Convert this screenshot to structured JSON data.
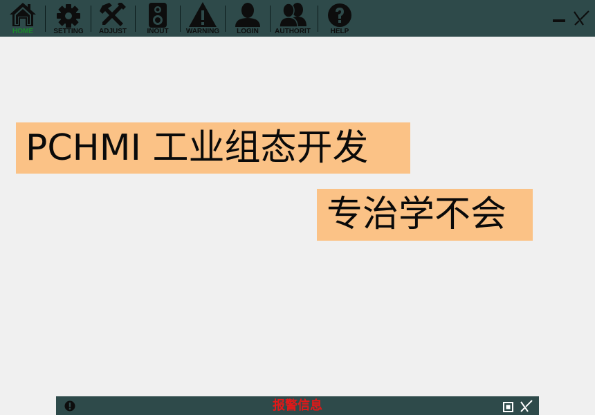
{
  "nav": {
    "items": [
      {
        "label": "HOME",
        "icon": "home-icon",
        "active": true
      },
      {
        "label": "SETTING",
        "icon": "gear-icon"
      },
      {
        "label": "ADJUST",
        "icon": "tools-icon"
      },
      {
        "label": "INOUT",
        "icon": "speaker-icon"
      },
      {
        "label": "WARNING",
        "icon": "warning-icon"
      },
      {
        "label": "LOGIN",
        "icon": "user-icon"
      },
      {
        "label": "AUTHORIT",
        "icon": "users-icon"
      },
      {
        "label": "HELP",
        "icon": "help-icon"
      }
    ]
  },
  "window": {
    "minimize_icon": "minimize-icon",
    "close_icon": "close-icon"
  },
  "main": {
    "banner_title": "PCHMI 工业组态开发",
    "banner_subtitle": "专治学不会"
  },
  "alarm": {
    "title": "报警信息",
    "info_icon": "alert-icon",
    "restore_icon": "restore-icon",
    "close_icon": "close-icon"
  },
  "colors": {
    "toolbar_bg": "#2e4a4a",
    "banner_bg": "#fbc286",
    "active_label": "#1a8a2a",
    "alarm_title": "#e21818",
    "page_bg": "#f0f0f0"
  }
}
